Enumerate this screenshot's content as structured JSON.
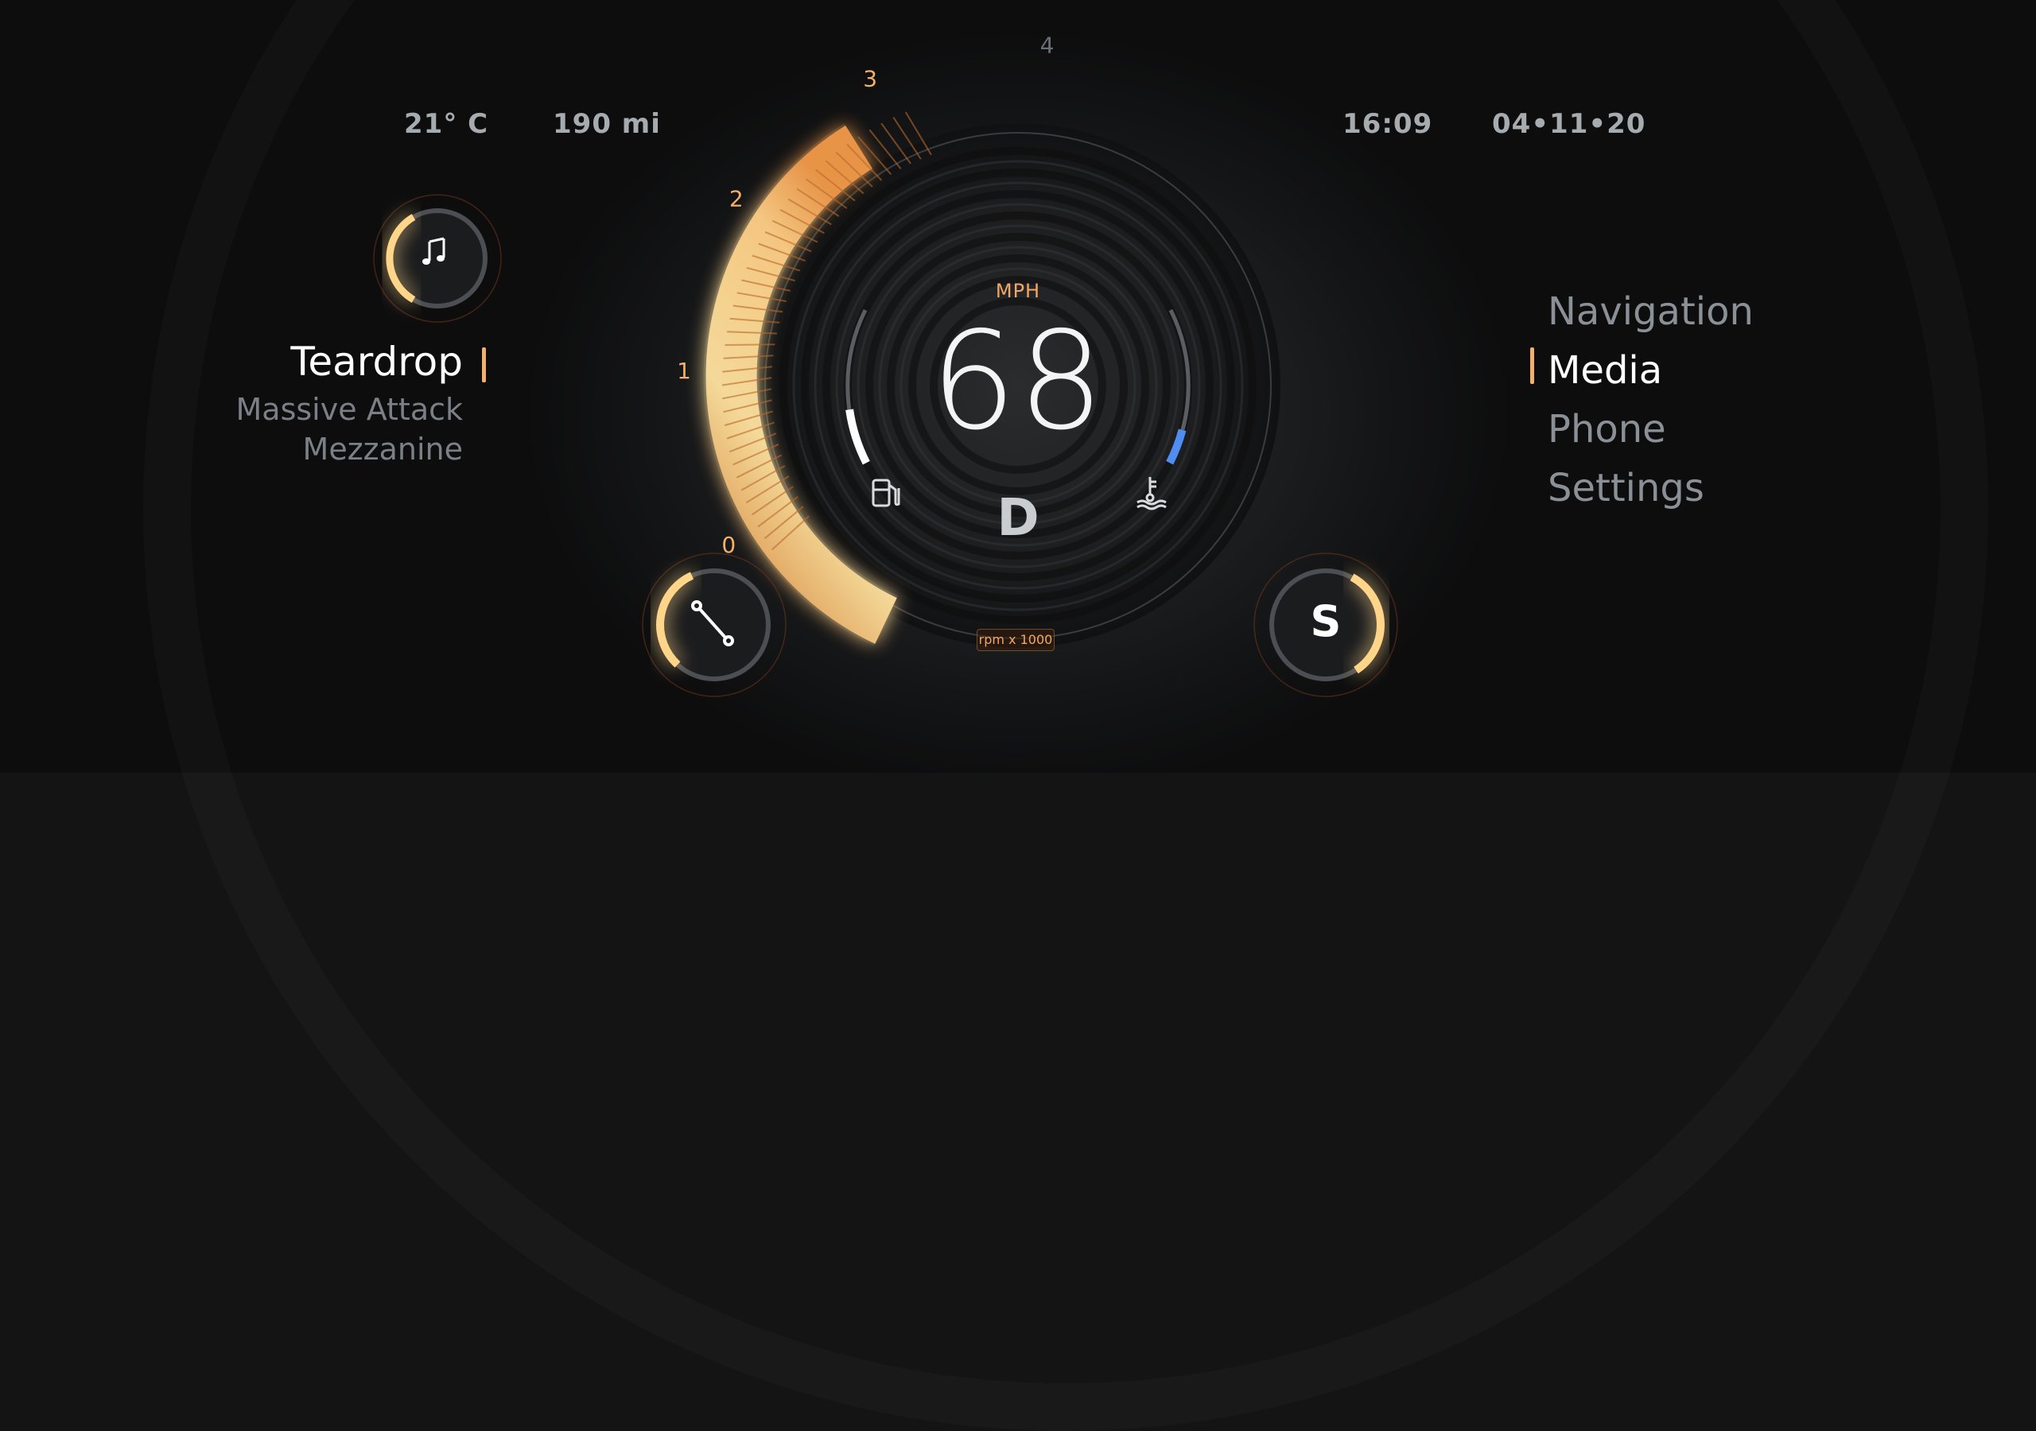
{
  "status_bar": {
    "temperature": "21° C",
    "range": "190 mi",
    "time": "16:09",
    "date": "04•11•20"
  },
  "media": {
    "title": "Teardrop",
    "artist": "Massive Attack",
    "album": "Mezzanine",
    "icon": "music-note-icon"
  },
  "menu": {
    "items": [
      {
        "label": "Navigation",
        "active": false
      },
      {
        "label": "Media",
        "active": true
      },
      {
        "label": "Phone",
        "active": false
      },
      {
        "label": "Settings",
        "active": false
      }
    ]
  },
  "speedometer": {
    "unit": "MPH",
    "speed": "68",
    "gear": "D",
    "rpm_unit": "rpm x 1000"
  },
  "tachometer": {
    "tick_labels": [
      "0",
      "1",
      "2",
      "3",
      "4"
    ],
    "rpm_value": 3.0,
    "rpm_max": 4
  },
  "gauges": {
    "fuel_level": 0.35,
    "coolant_level": 0.22,
    "fuel_icon": "fuel-pump-icon",
    "coolant_icon": "coolant-temperature-icon"
  },
  "drive_mode": {
    "letter": "S",
    "wiper_icon": "wiper-icon"
  },
  "colors": {
    "accent": "#f2b06a",
    "accent_bright": "#ffd58a",
    "coolant": "#4f8ef0",
    "background": "#141414"
  }
}
